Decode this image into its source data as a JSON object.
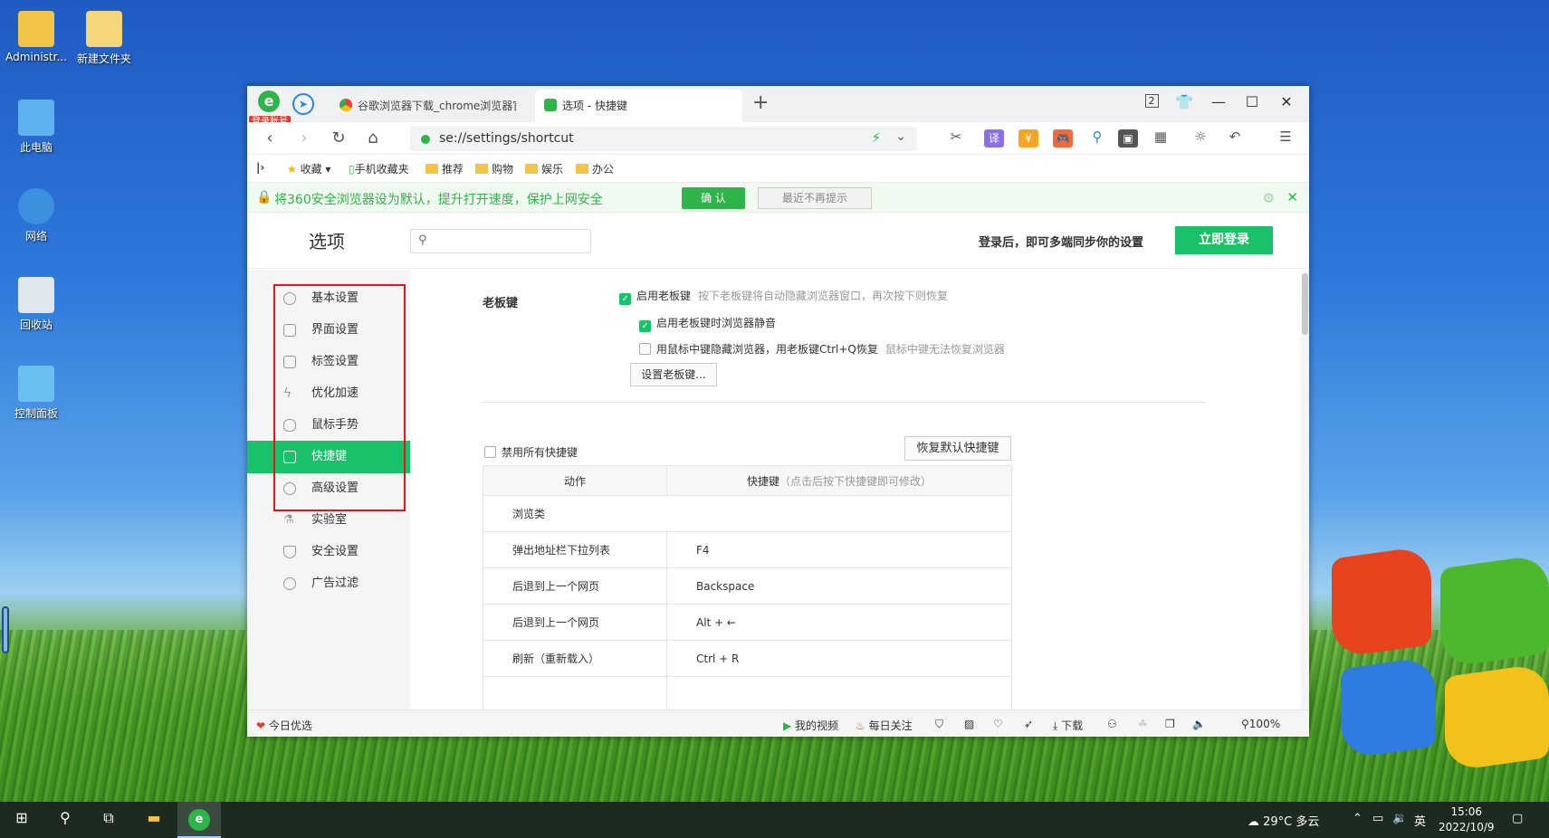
{
  "desktop": {
    "icons": [
      {
        "label": "Administr..."
      },
      {
        "label": "新建文件夹"
      },
      {
        "label": "此电脑"
      },
      {
        "label": "网络"
      },
      {
        "label": "回收站"
      },
      {
        "label": "控制面板"
      }
    ]
  },
  "browser": {
    "login_badge": "登录账号",
    "tabs": [
      {
        "title": "谷歌浏览器下载_chrome浏览器官网"
      },
      {
        "title": "选项 - 快捷键"
      }
    ],
    "new_tab": "+",
    "window_controls": {
      "restore_count": "2",
      "minimize": "—",
      "maximize": "☐",
      "close": "✕"
    },
    "address": {
      "url": "se://settings/shortcut"
    },
    "bookmarks": [
      {
        "label": "收藏"
      },
      {
        "label": "手机收藏夹"
      },
      {
        "label": "推荐"
      },
      {
        "label": "购物"
      },
      {
        "label": "娱乐"
      },
      {
        "label": "办公"
      }
    ],
    "notice": {
      "message": "将360安全浏览器设为默认，提升打开速度，保护上网安全",
      "confirm": "确 认",
      "later": "最近不再提示"
    },
    "settings": {
      "title": "选项",
      "search_placeholder": "",
      "sync_text": "登录后，即可多端同步你的设置",
      "login_button": "立即登录",
      "sidebar": [
        {
          "label": "基本设置"
        },
        {
          "label": "界面设置"
        },
        {
          "label": "标签设置"
        },
        {
          "label": "优化加速"
        },
        {
          "label": "鼠标手势"
        },
        {
          "label": "快捷键",
          "active": true
        },
        {
          "label": "高级设置"
        },
        {
          "label": "实验室"
        },
        {
          "label": "安全设置"
        },
        {
          "label": "广告过滤"
        }
      ],
      "boss_key": {
        "label": "老板键",
        "enable": {
          "text": "启用老板键",
          "hint": "按下老板键将自动隐藏浏览器窗口，再次按下则恢复",
          "checked": true
        },
        "mute": {
          "text": "启用老板键时浏览器静音",
          "checked": true
        },
        "middle_click": {
          "text": "用鼠标中键隐藏浏览器，用老板键Ctrl+Q恢复",
          "hint": "鼠标中键无法恢复浏览器",
          "checked": false
        },
        "set_button": "设置老板键..."
      },
      "shortcuts": {
        "disable_all": {
          "text": "禁用所有快捷键",
          "checked": false
        },
        "restore_button": "恢复默认快捷键",
        "headers": {
          "action": "动作",
          "key": "快捷键",
          "key_hint": "（点击后按下快捷键即可修改）"
        },
        "group": "浏览类",
        "rows": [
          {
            "action": "弹出地址栏下拉列表",
            "key": "F4"
          },
          {
            "action": "后退到上一个网页",
            "key": "Backspace"
          },
          {
            "action": "后退到上一个网页",
            "key": "Alt + ←"
          },
          {
            "action": "刷新（重新载入）",
            "key": "Ctrl + R"
          }
        ]
      }
    },
    "statusbar": {
      "today": "今日优选",
      "video": "我的视频",
      "daily": "每日关注",
      "download": "下载",
      "zoom": "100%"
    }
  },
  "taskbar": {
    "weather": "29°C 多云",
    "ime": "英",
    "time": "15:06",
    "date": "2022/10/9"
  }
}
